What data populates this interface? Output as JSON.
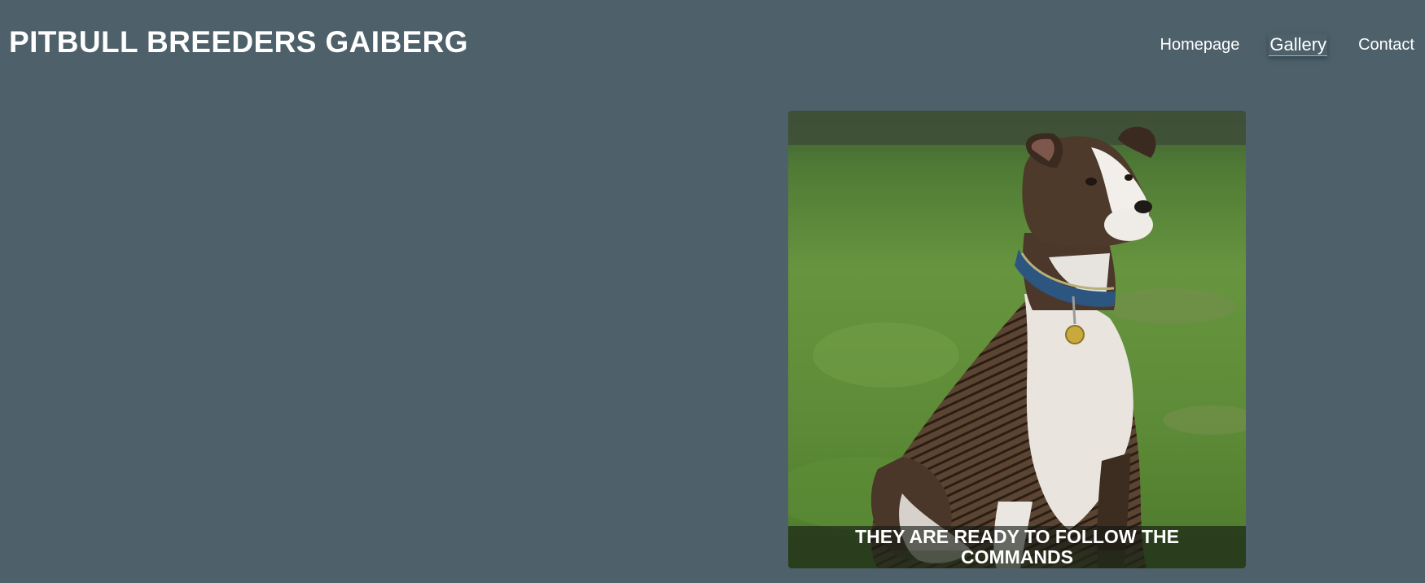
{
  "header": {
    "site_title": "PITBULL BREEDERS GAIBERG"
  },
  "nav": {
    "items": [
      {
        "label": "Homepage",
        "active": false
      },
      {
        "label": "Gallery",
        "active": true
      },
      {
        "label": "Contact",
        "active": false
      }
    ]
  },
  "gallery": {
    "photo_subject": "brindle-pitbull-sitting-on-grass",
    "caption": "THEY ARE READY TO FOLLOW THE COMMANDS"
  },
  "colors": {
    "page_background": "#4e616b",
    "text": "#ffffff",
    "caption_overlay": "rgba(20,24,20,0.62)"
  }
}
